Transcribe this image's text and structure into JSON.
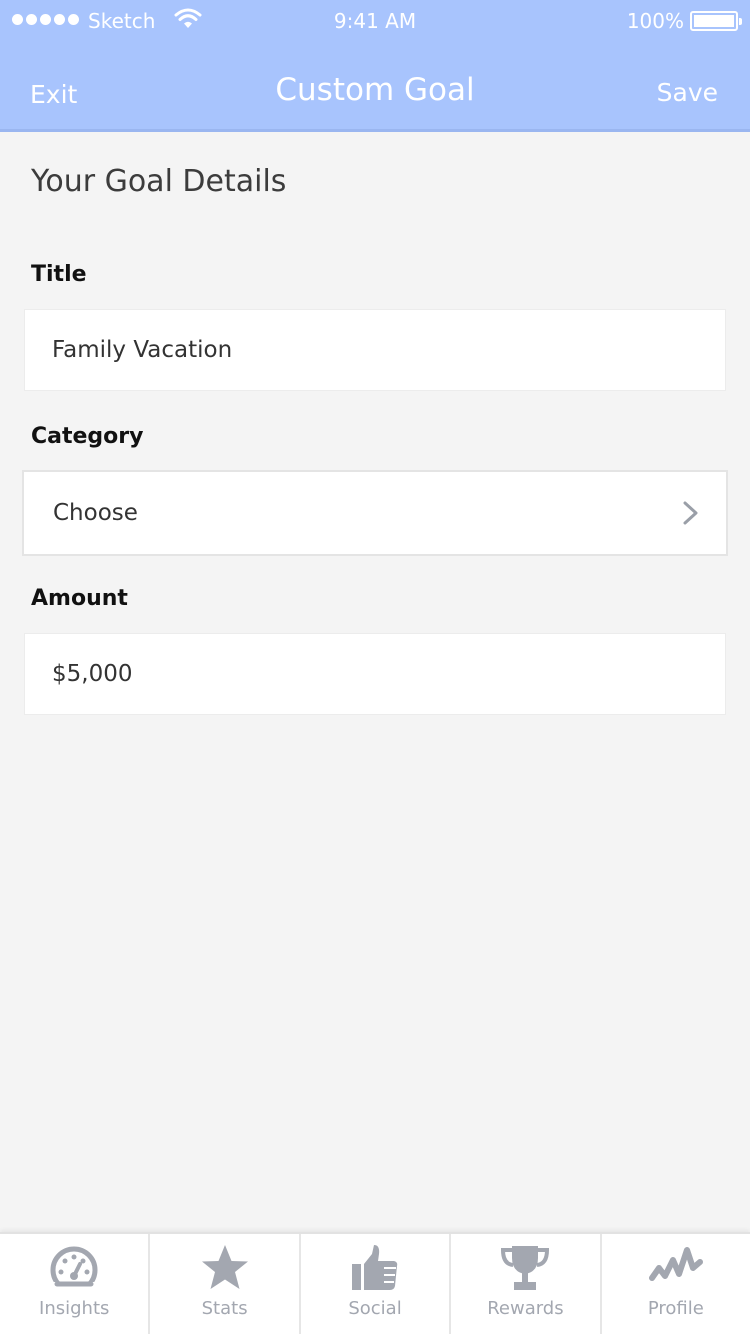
{
  "status_bar": {
    "carrier": "Sketch",
    "time": "9:41 AM",
    "battery": "100%"
  },
  "nav": {
    "exit_label": "Exit",
    "title": "Custom Goal",
    "save_label": "Save"
  },
  "form": {
    "heading": "Your Goal Details",
    "title_label": "Title",
    "title_value": "Family Vacation",
    "category_label": "Category",
    "category_value": "Choose",
    "amount_label": "Amount",
    "amount_value": "$5,000"
  },
  "tabs": [
    {
      "label": "Insights",
      "icon": "speedometer-icon"
    },
    {
      "label": "Stats",
      "icon": "star-icon"
    },
    {
      "label": "Social",
      "icon": "thumbs-up-icon"
    },
    {
      "label": "Rewards",
      "icon": "trophy-icon"
    },
    {
      "label": "Profile",
      "icon": "activity-icon"
    }
  ],
  "colors": {
    "header_bg": "#a8c4fd",
    "background": "#f4f4f4",
    "tab_icon": "#a3a7b0"
  }
}
